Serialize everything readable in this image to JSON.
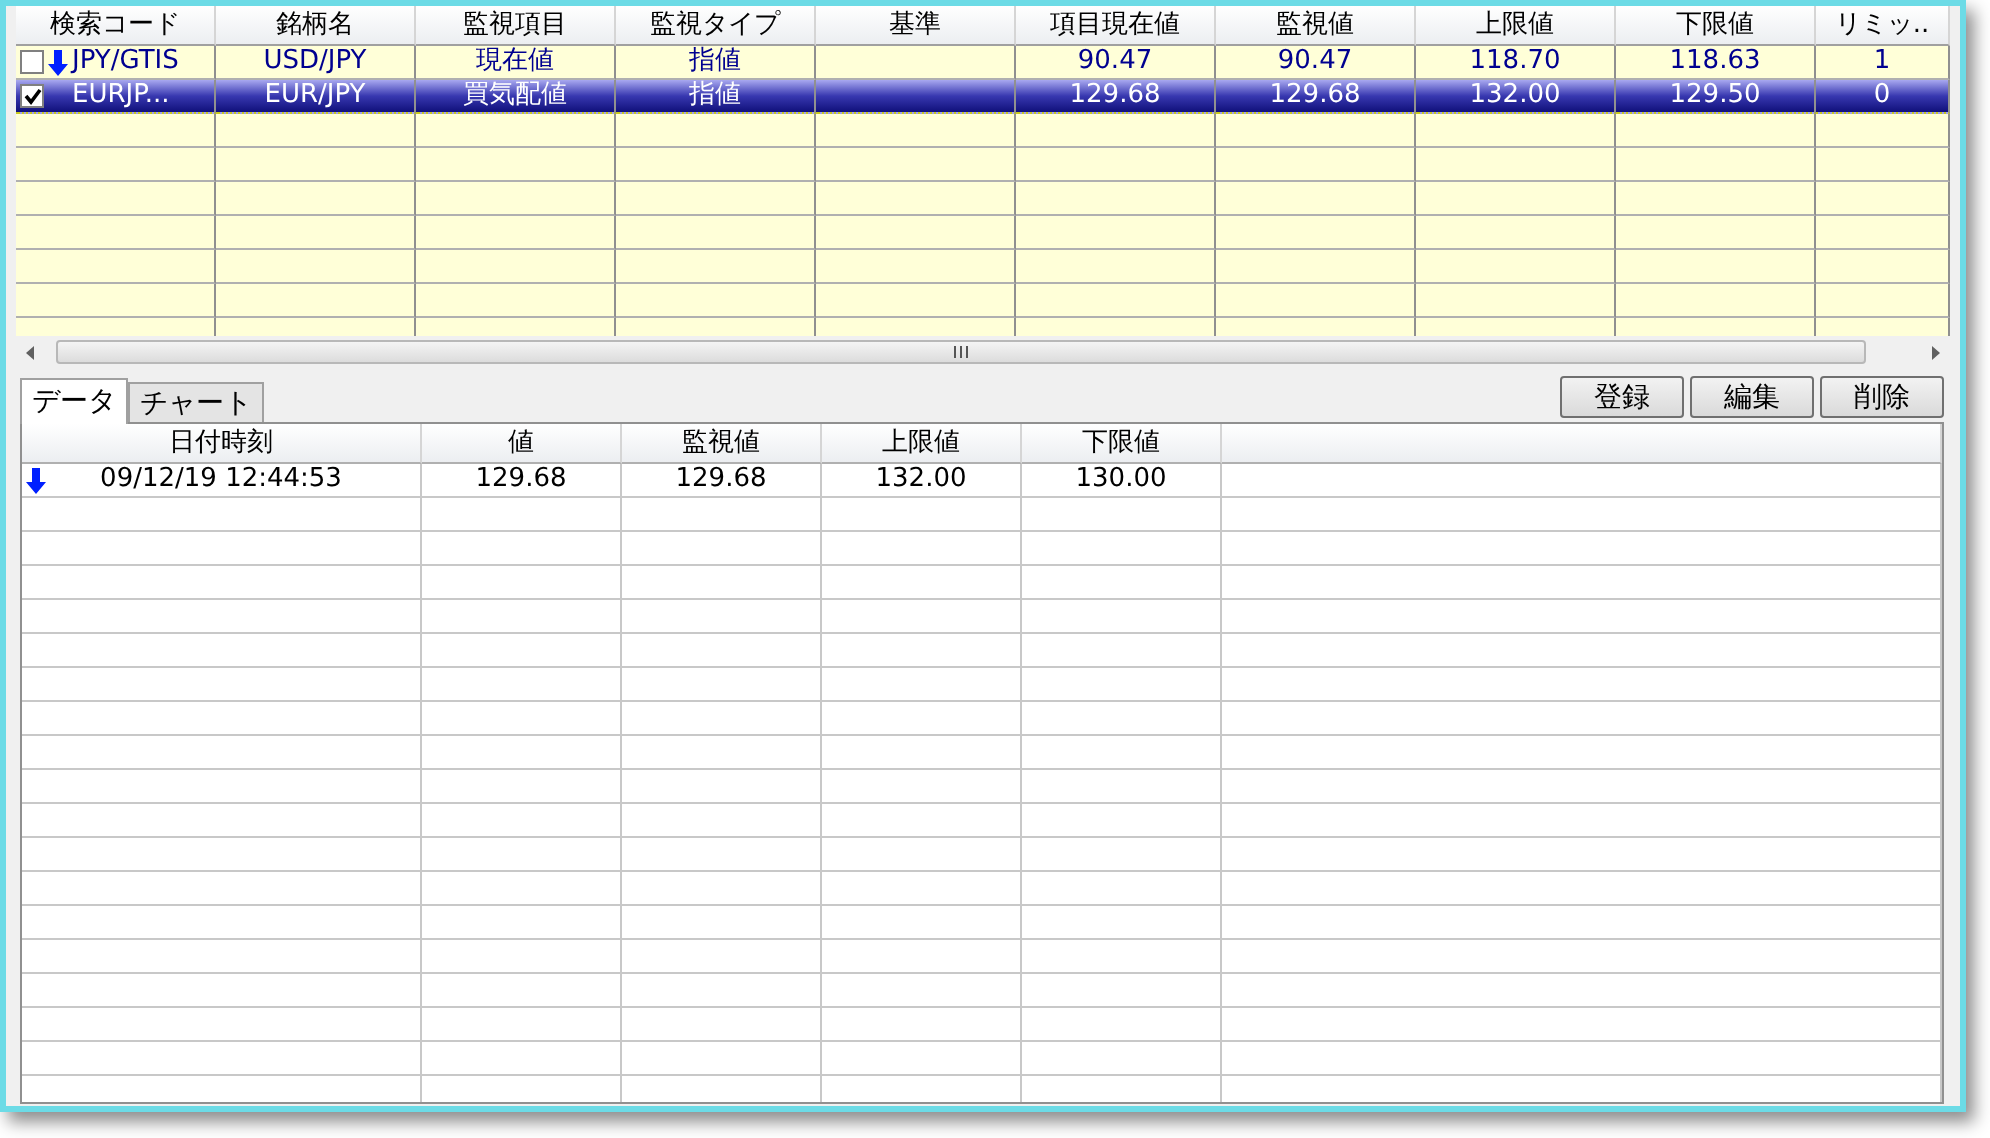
{
  "top_table": {
    "columns": [
      "検索コード",
      "銘柄名",
      "監視項目",
      "監視タイプ",
      "基準",
      "項目現在値",
      "監視値",
      "上限値",
      "下限値",
      "リミッ.."
    ],
    "rows": [
      {
        "selected": false,
        "checked": false,
        "alert": true,
        "cells": [
          "JPY/GTIS",
          "USD/JPY",
          "現在値",
          "指値",
          "",
          "90.47",
          "90.47",
          "118.70",
          "118.63",
          "1"
        ]
      },
      {
        "selected": true,
        "checked": true,
        "alert": false,
        "cells": [
          "EURJP...",
          "EUR/JPY",
          "買気配値",
          "指値",
          "",
          "129.68",
          "129.68",
          "132.00",
          "129.50",
          "0"
        ]
      }
    ]
  },
  "tabs": [
    {
      "label": "データ",
      "selected": true
    },
    {
      "label": "チャート",
      "selected": false
    }
  ],
  "buttons": [
    "登録",
    "編集",
    "削除"
  ],
  "data_table": {
    "columns": [
      "日付時刻",
      "値",
      "監視値",
      "上限値",
      "下限値"
    ],
    "rows": [
      {
        "alert": true,
        "cells": [
          "09/12/19 12:44:53",
          "129.68",
          "129.68",
          "132.00",
          "130.00"
        ]
      }
    ]
  }
}
